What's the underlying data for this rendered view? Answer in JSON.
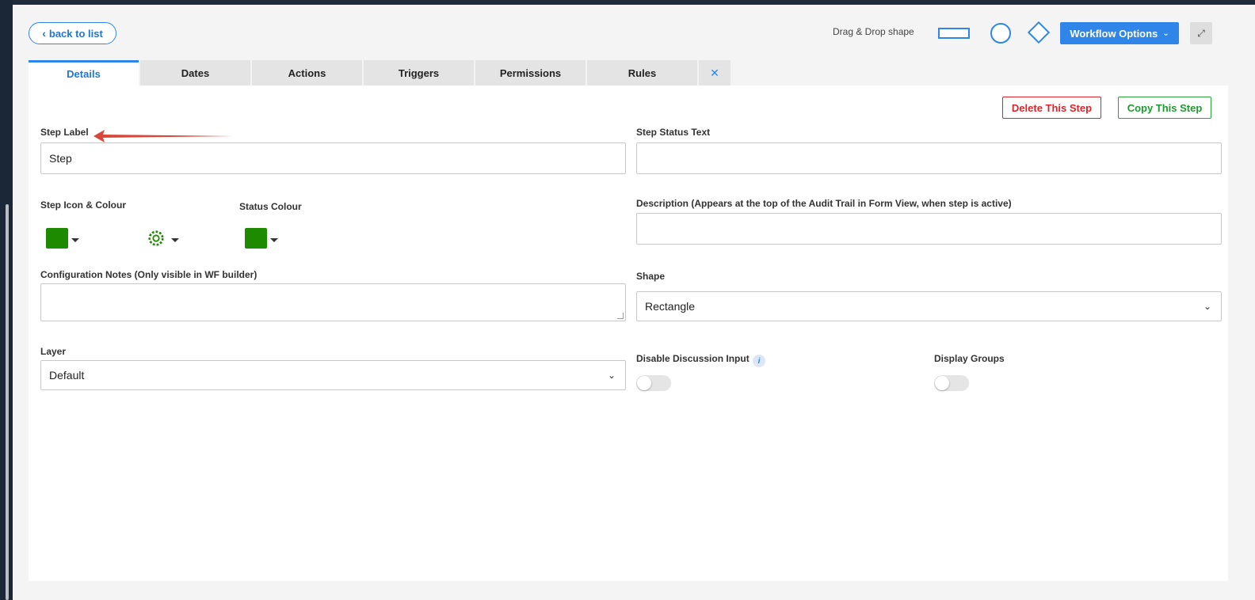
{
  "header": {
    "back_label": "back to list",
    "drag_drop_label": "Drag & Drop shape",
    "workflow_options_label": "Workflow Options"
  },
  "tabs": [
    {
      "label": "Details",
      "active": true
    },
    {
      "label": "Dates"
    },
    {
      "label": "Actions"
    },
    {
      "label": "Triggers"
    },
    {
      "label": "Permissions"
    },
    {
      "label": "Rules"
    }
  ],
  "actions": {
    "delete_label": "Delete This Step",
    "copy_label": "Copy This Step"
  },
  "form": {
    "step_label": {
      "label": "Step Label",
      "value": "Step"
    },
    "step_status_text": {
      "label": "Step Status Text",
      "value": ""
    },
    "step_icon_colour": {
      "label": "Step Icon & Colour",
      "color": "#1e8a00",
      "icon": "gear-icon"
    },
    "status_colour": {
      "label": "Status Colour",
      "color": "#1e8a00"
    },
    "description": {
      "label": "Description (Appears at the top of the Audit Trail in Form View, when step is active)",
      "value": ""
    },
    "config_notes": {
      "label": "Configuration Notes (Only visible in WF builder)",
      "value": ""
    },
    "shape": {
      "label": "Shape",
      "value": "Rectangle"
    },
    "layer": {
      "label": "Layer",
      "value": "Default"
    },
    "disable_discussion": {
      "label": "Disable Discussion Input",
      "enabled": false
    },
    "display_groups": {
      "label": "Display Groups",
      "enabled": false
    }
  },
  "colors": {
    "accent": "#2f86e8",
    "danger": "#d9252b",
    "success": "#1d9a2f",
    "annotation_arrow": "#d9463a"
  }
}
